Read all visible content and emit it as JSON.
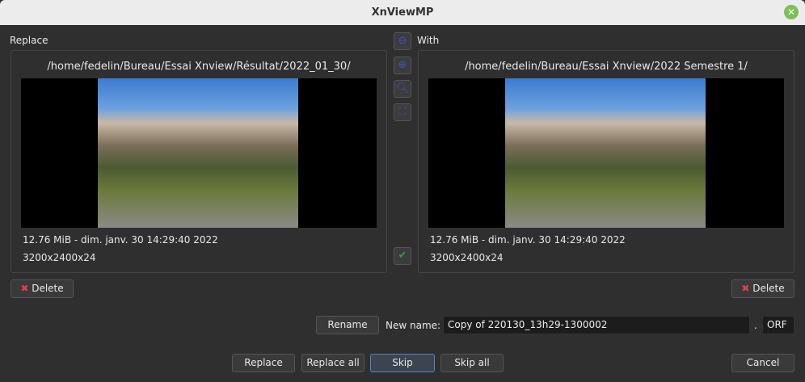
{
  "window": {
    "title": "XnViewMP"
  },
  "left": {
    "label": "Replace",
    "path": "/home/fedelin/Bureau/Essai Xnview/Résultat/2022_01_30/",
    "info": "12.76 MiB - dim. janv. 30 14:29:40 2022",
    "dims": "3200x2400x24",
    "delete": "Delete"
  },
  "right": {
    "label": "With",
    "path": "/home/fedelin/Bureau/Essai Xnview/2022 Semestre 1/",
    "info": "12.76 MiB - dim. janv. 30 14:29:40 2022",
    "dims": "3200x2400x24",
    "delete": "Delete"
  },
  "tools": [
    "zoom-out-icon",
    "zoom-in-icon",
    "zoom-fit-icon",
    "fullscreen-icon",
    "checkmark-icon"
  ],
  "rename": {
    "button": "Rename",
    "label": "New name:",
    "value": "Copy of 220130_13h29-1300002",
    "dot": ".",
    "ext": "ORF"
  },
  "actions": {
    "replace": "Replace",
    "replace_all": "Replace all",
    "skip": "Skip",
    "skip_all": "Skip all",
    "cancel": "Cancel"
  }
}
